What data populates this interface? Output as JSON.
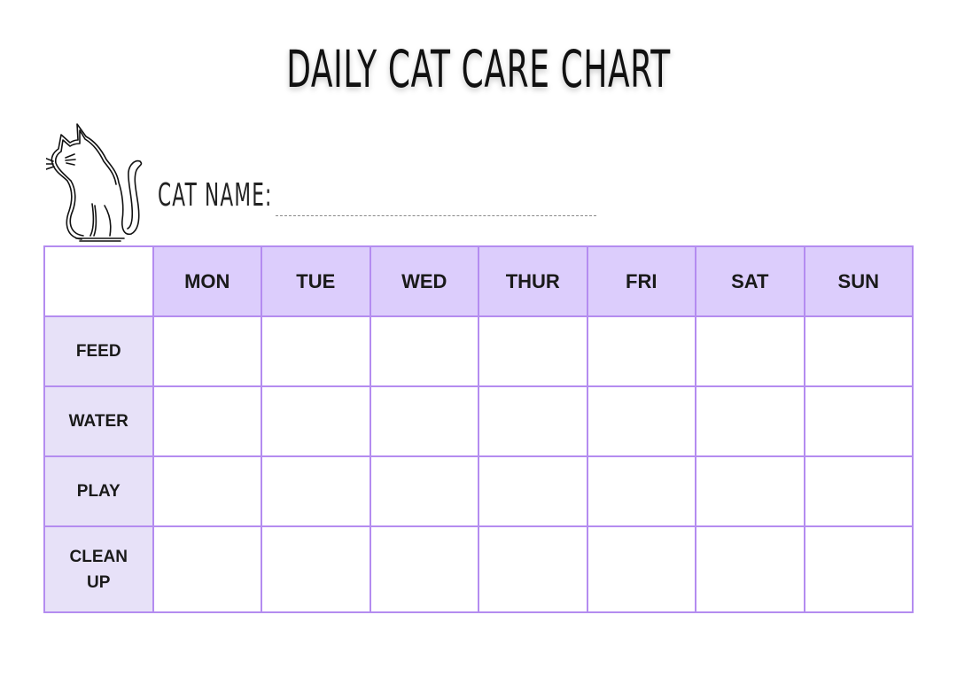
{
  "title": "DAILY CAT CARE CHART",
  "cat_name_label": "CAT NAME:",
  "illustration": {
    "icon": "cat-outline-icon"
  },
  "table": {
    "days": [
      "MON",
      "TUE",
      "WED",
      "THUR",
      "FRI",
      "SAT",
      "SUN"
    ],
    "tasks": [
      {
        "label_lines": [
          "FEED"
        ]
      },
      {
        "label_lines": [
          "WATER"
        ]
      },
      {
        "label_lines": [
          "PLAY"
        ]
      },
      {
        "label_lines": [
          "CLEAN",
          "UP"
        ]
      }
    ]
  },
  "colors": {
    "grid_border": "#b48cf0",
    "header_fill": "#dccdfc",
    "row_label_fill": "#e7e1f8",
    "text": "#1a1a1a"
  }
}
